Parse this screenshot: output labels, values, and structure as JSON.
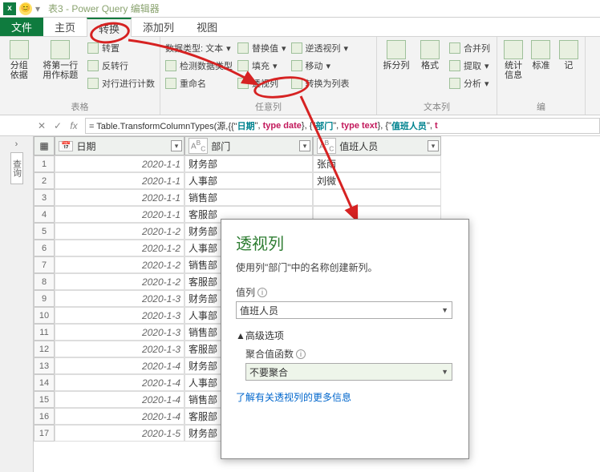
{
  "title_bar": {
    "app_icon": "x",
    "emoji": "😊",
    "text": "表3 - Power Query 编辑器"
  },
  "tabs": {
    "file": "文件",
    "home": "主页",
    "transform": "转换",
    "addcol": "添加列",
    "view": "视图"
  },
  "ribbon": {
    "group1_label": "表格",
    "group_by": "分组\n依据",
    "first_row": "将第一行\n用作标题",
    "transpose": "转置",
    "reverse": "反转行",
    "count": "对行进行计数",
    "anycol_label": "任意列",
    "datatype": "数据类型: 文本",
    "detect": "检测数据类型",
    "rename": "重命名",
    "replace": "替换值",
    "fill": "填充",
    "pivot": "透视列",
    "unpivot": "逆透视列",
    "move": "移动",
    "tolist": "转换为列表",
    "textcol_label": "文本列",
    "split": "拆分列",
    "format": "格式",
    "merge": "合并列",
    "extract": "提取",
    "parse": "分析",
    "numcol_label": "编",
    "stats": "统计信息",
    "std": "标准",
    "note": "记"
  },
  "formula": {
    "prefix": "= Table.TransformColumnTypes(源,{{\"",
    "c1": "日期",
    "t1": "type date",
    "c2": "部门",
    "t2": "type text",
    "c3": "值班人员",
    "tail": "t"
  },
  "columns": {
    "date": "日期",
    "dept": "部门",
    "person": "值班人员"
  },
  "rows": [
    {
      "n": 1,
      "date": "2020-1-1",
      "dept": "财务部",
      "person": "张雨"
    },
    {
      "n": 2,
      "date": "2020-1-1",
      "dept": "人事部",
      "person": "刘微"
    },
    {
      "n": 3,
      "date": "2020-1-1",
      "dept": "销售部",
      "person": ""
    },
    {
      "n": 4,
      "date": "2020-1-1",
      "dept": "客服部",
      "person": ""
    },
    {
      "n": 5,
      "date": "2020-1-2",
      "dept": "财务部",
      "person": ""
    },
    {
      "n": 6,
      "date": "2020-1-2",
      "dept": "人事部",
      "person": ""
    },
    {
      "n": 7,
      "date": "2020-1-2",
      "dept": "销售部",
      "person": ""
    },
    {
      "n": 8,
      "date": "2020-1-2",
      "dept": "客服部",
      "person": ""
    },
    {
      "n": 9,
      "date": "2020-1-3",
      "dept": "财务部",
      "person": ""
    },
    {
      "n": 10,
      "date": "2020-1-3",
      "dept": "人事部",
      "person": ""
    },
    {
      "n": 11,
      "date": "2020-1-3",
      "dept": "销售部",
      "person": ""
    },
    {
      "n": 12,
      "date": "2020-1-3",
      "dept": "客服部",
      "person": ""
    },
    {
      "n": 13,
      "date": "2020-1-4",
      "dept": "财务部",
      "person": ""
    },
    {
      "n": 14,
      "date": "2020-1-4",
      "dept": "人事部",
      "person": ""
    },
    {
      "n": 15,
      "date": "2020-1-4",
      "dept": "销售部",
      "person": ""
    },
    {
      "n": 16,
      "date": "2020-1-4",
      "dept": "客服部",
      "person": ""
    },
    {
      "n": 17,
      "date": "2020-1-5",
      "dept": "财务部",
      "person": ""
    }
  ],
  "dialog": {
    "title": "透视列",
    "desc": "使用列\"部门\"中的名称创建新列。",
    "value_label": "值列",
    "value_sel": "值班人员",
    "adv": "▲高级选项",
    "agg_label": "聚合值函数",
    "agg_sel": "不要聚合",
    "link": "了解有关透视列的更多信息"
  },
  "rail": "查询"
}
